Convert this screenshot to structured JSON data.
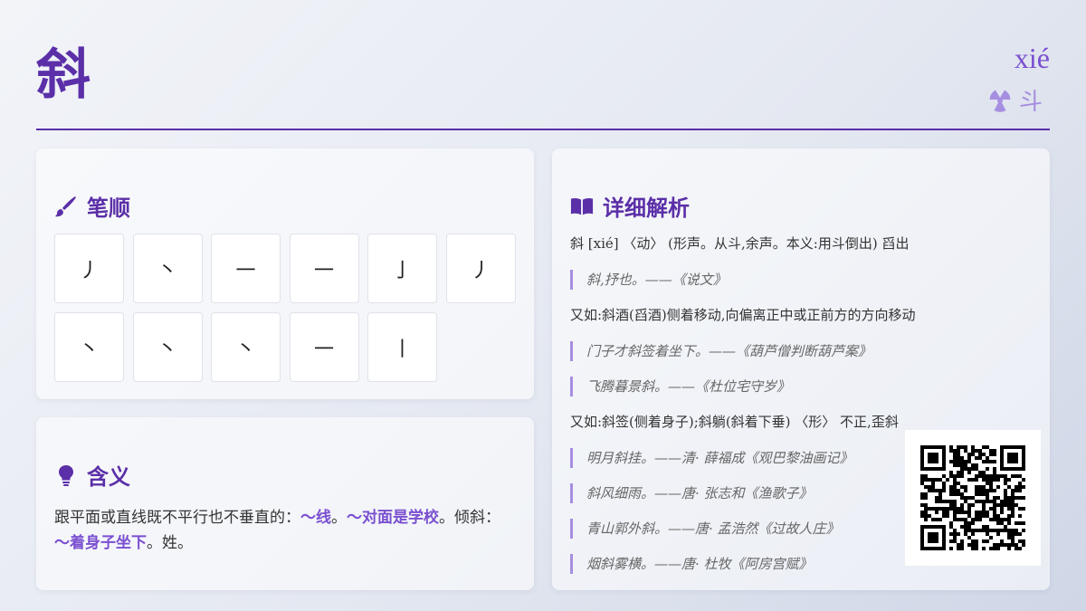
{
  "header": {
    "character": "斜",
    "pinyin": "xié",
    "radical": "斗",
    "radical_icon": "radiation-icon"
  },
  "strokes": {
    "title": "笔顺",
    "icon": "brush-icon",
    "items": [
      "丿",
      "丶",
      "一",
      "一",
      "亅",
      "丿",
      "丶",
      "丶",
      "丶",
      "一",
      "丨"
    ]
  },
  "meaning": {
    "title": "含义",
    "icon": "lightbulb-icon",
    "text_1": "跟平面或直线既不平行也不垂直的：",
    "hl_1": "～线",
    "text_2": "。",
    "hl_2": "～对面是学校",
    "text_3": "。倾斜：",
    "hl_3": "～着身子坐下",
    "text_4": "。姓。"
  },
  "detail": {
    "title": "详细解析",
    "icon": "book-icon",
    "line_1": "斜 [xié] 〈动〉 (形声。从斗,余声。本义:用斗倒出) 舀出",
    "quote_1": "斜,抒也。——《说文》",
    "line_2": "又如:斜酒(舀酒)侧着移动,向偏离正中或正前方的方向移动",
    "quote_2": "门子才斜签着坐下。——《葫芦僧判断葫芦案》",
    "quote_3": "飞腾暮景斜。——《杜位宅守岁》",
    "line_3": "又如:斜签(侧着身子);斜躺(斜着下垂) 〈形〉 不正,歪斜",
    "quote_4": "明月斜挂。——清· 薛福成《观巴黎油画记》",
    "quote_5": "斜风细雨。——唐· 张志和《渔歌子》",
    "quote_6": "青山郭外斜。——唐· 孟浩然《过故人庄》",
    "quote_7": "烟斜雾横。——唐· 杜牧《阿房宫赋》"
  },
  "qr": {
    "icon": "qr-code-icon"
  }
}
